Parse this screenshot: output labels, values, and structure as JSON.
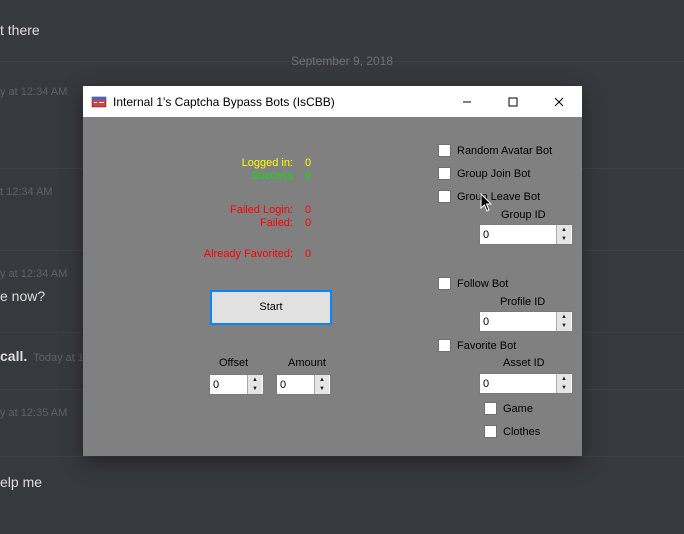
{
  "chat": {
    "msg1": "t there",
    "date_divider": "September 9, 2018",
    "meta1": "y at 12:34 AM",
    "meta2": "t 12:34 AM",
    "meta3": "y at 12:34 AM",
    "msg_now": "e now?",
    "call_text": "call.",
    "call_meta": "Today at 1",
    "meta4": "y at 12:35 AM",
    "msg_help": "elp me"
  },
  "window": {
    "title": "Internal 1's Captcha Bypass Bots (IsCBB)",
    "stats": {
      "logged_in_label": "Logged in:",
      "logged_in_value": "0",
      "success_label": "Success",
      "success_value": "0",
      "failed_login_label": "Failed Login:",
      "failed_login_value": "0",
      "failed_label": "Failed:",
      "failed_value": "0",
      "already_fav_label": "Already Favorited:",
      "already_fav_value": "0"
    },
    "start_button": "Start",
    "offset_label": "Offset",
    "offset_value": "0",
    "amount_label": "Amount",
    "amount_value": "0",
    "bots": {
      "random_avatar": "Random Avatar Bot",
      "group_join": "Group Join Bot",
      "group_leave": "Group Leave Bot",
      "group_id_label": "Group ID",
      "group_id_value": "0",
      "follow": "Follow Bot",
      "profile_id_label": "Profile ID",
      "profile_id_value": "0",
      "favorite": "Favorite Bot",
      "asset_id_label": "Asset ID",
      "asset_id_value": "0",
      "game": "Game",
      "clothes": "Clothes"
    }
  }
}
